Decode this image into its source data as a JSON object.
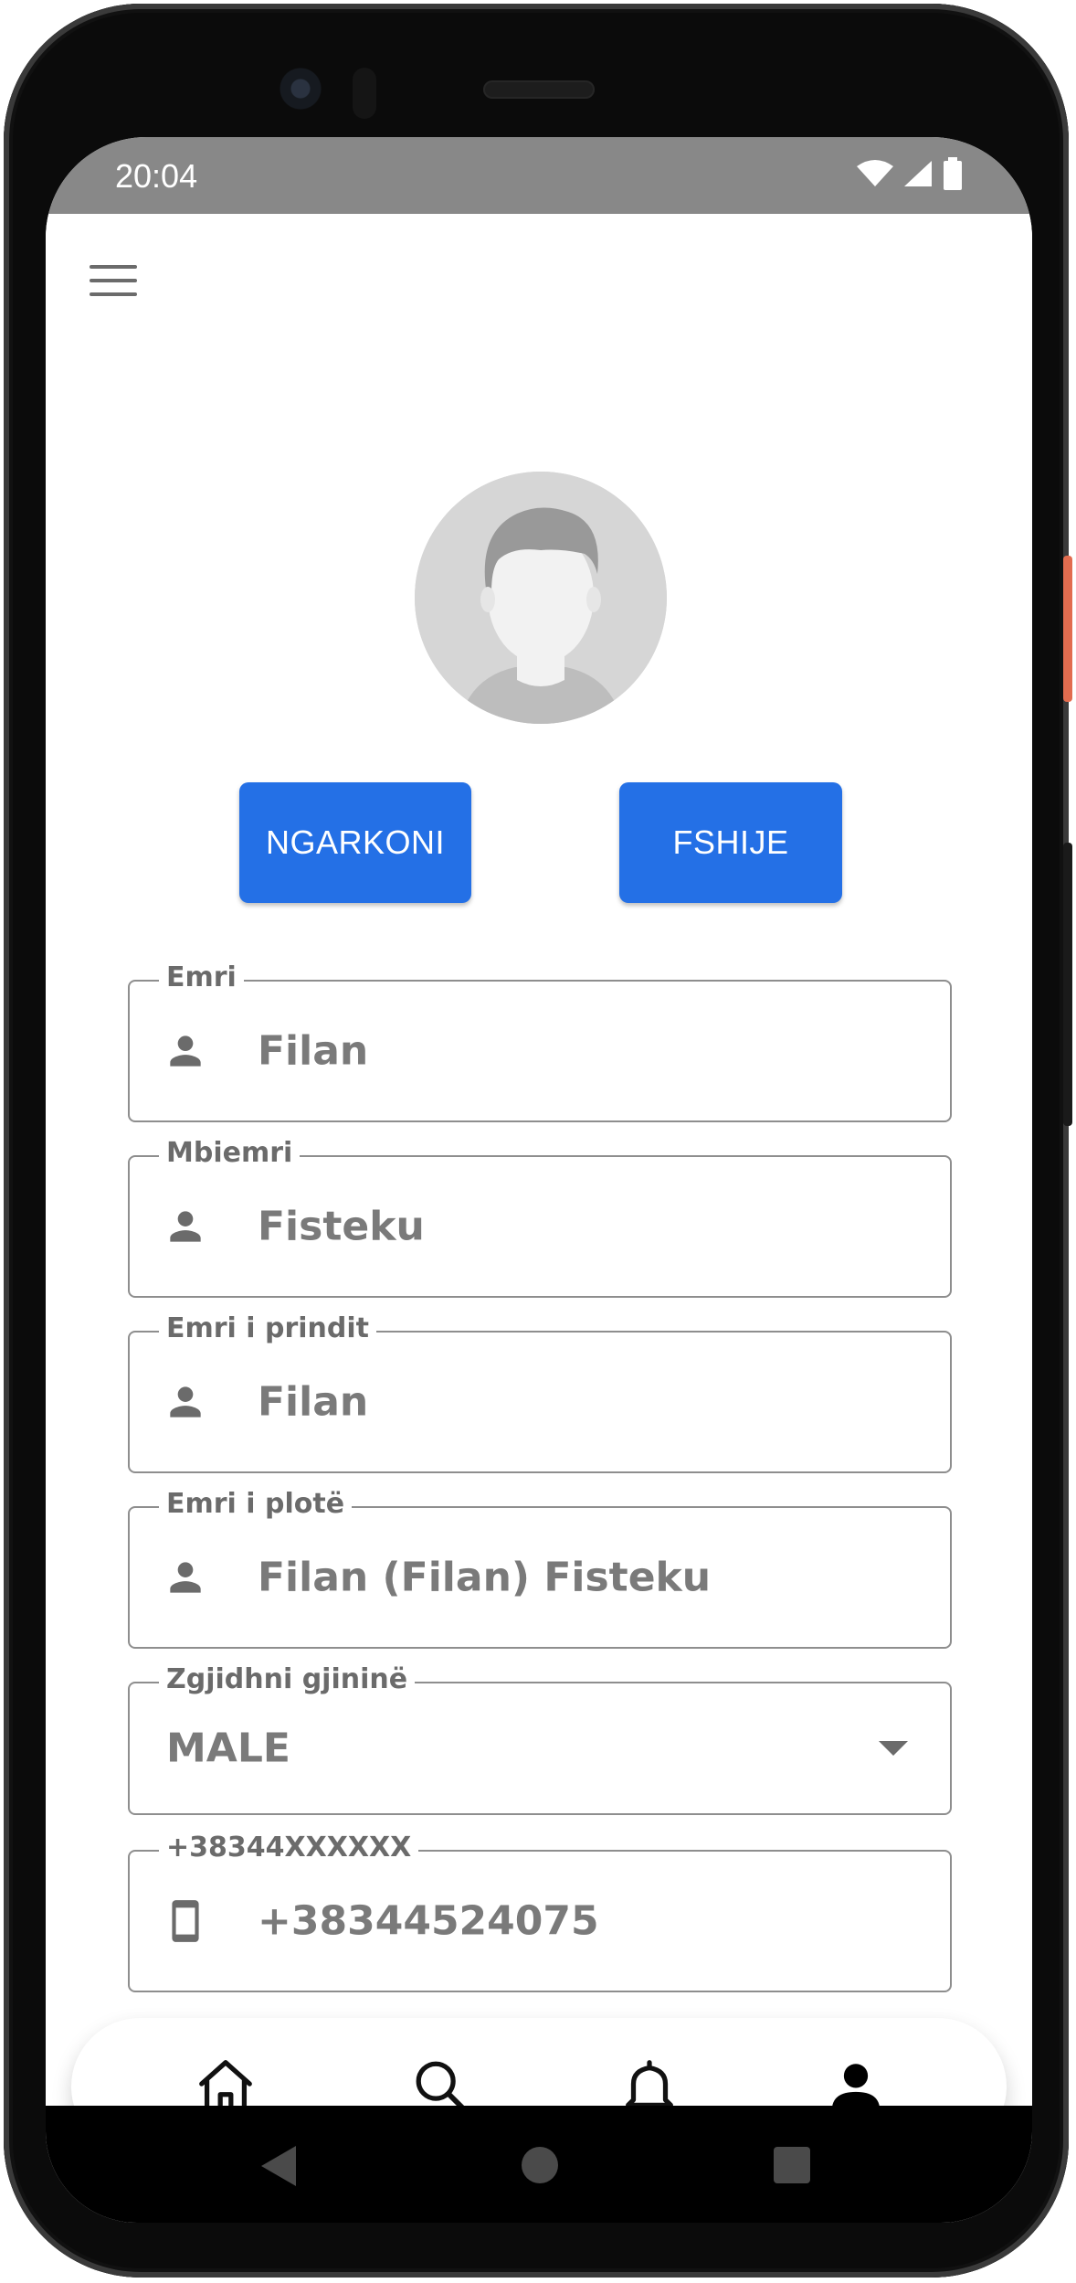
{
  "status_bar": {
    "time": "20:04"
  },
  "profile": {
    "upload_label": "NGARKONI",
    "delete_label": "FSHIJE"
  },
  "fields": {
    "first_name": {
      "label": "Emri",
      "value": "Filan"
    },
    "last_name": {
      "label": "Mbiemri",
      "value": "Fisteku"
    },
    "parent_name": {
      "label": "Emri i prindit",
      "value": "Filan"
    },
    "full_name": {
      "label": "Emri i plotë",
      "value": "Filan (Filan) Fisteku"
    },
    "gender": {
      "label": "Zgjidhni gjininë",
      "value": "MALE"
    },
    "phone": {
      "label": "+38344XXXXXX",
      "value": "+38344524075"
    }
  },
  "bottom_nav": {
    "items": [
      {
        "icon": "home-icon",
        "active": false
      },
      {
        "icon": "search-icon",
        "active": false
      },
      {
        "icon": "bell-icon",
        "active": false
      },
      {
        "icon": "person-icon",
        "active": true
      }
    ]
  },
  "colors": {
    "primary": "#2470e6",
    "status_bar": "#888888",
    "field_text": "#7a7a7a",
    "field_border": "#8e8e8e"
  }
}
